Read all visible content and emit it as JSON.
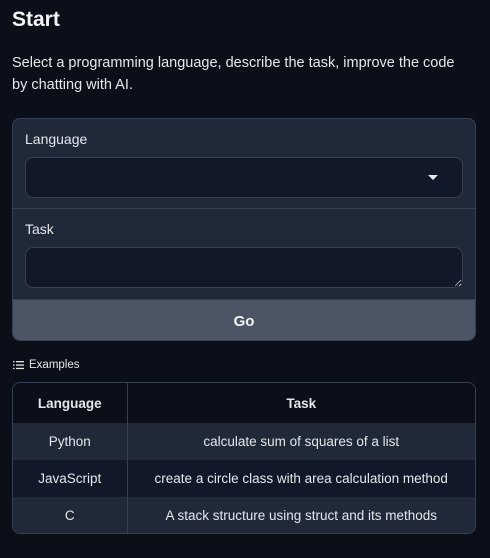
{
  "header": {
    "title": "Start",
    "description": "Select a programming language, describe the task, improve the code by chatting with AI."
  },
  "form": {
    "language_label": "Language",
    "language_value": "",
    "task_label": "Task",
    "task_value": "",
    "go_label": "Go"
  },
  "examples": {
    "label": "Examples",
    "columns": [
      "Language",
      "Task"
    ],
    "rows": [
      [
        "Python",
        "calculate sum of squares of a list"
      ],
      [
        "JavaScript",
        "create a circle class with area calculation method"
      ],
      [
        "C",
        "A stack structure using struct and its methods"
      ]
    ]
  },
  "icons": {
    "dropdown": "chevron-down-icon",
    "examples": "list-icon"
  }
}
